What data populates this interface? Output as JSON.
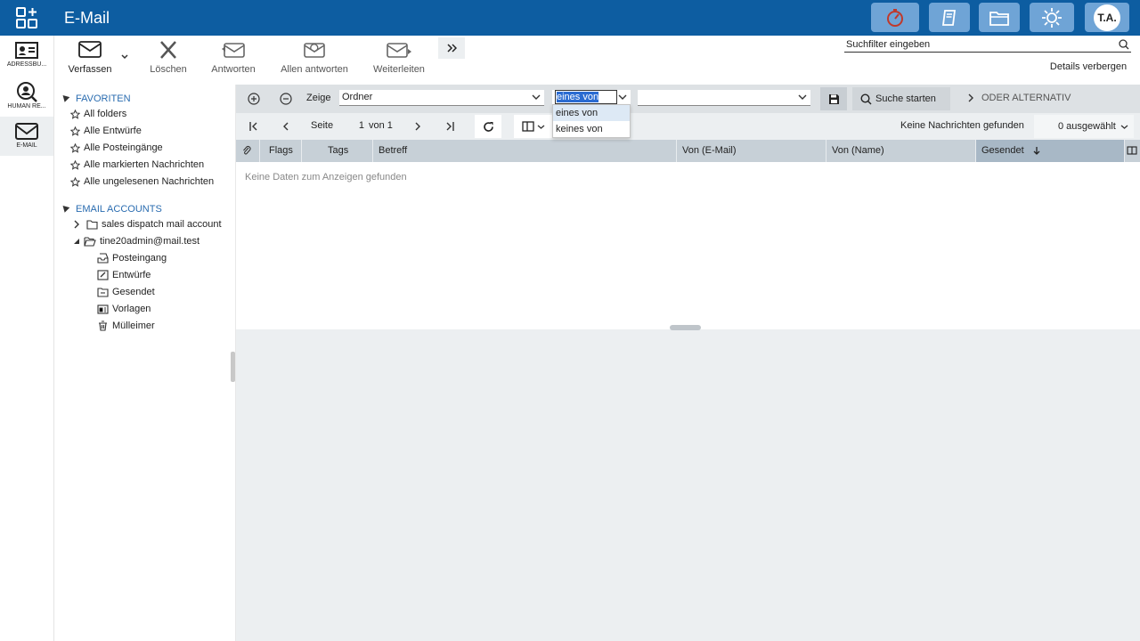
{
  "app": {
    "title": "E-Mail",
    "user_initials": "T.A."
  },
  "icons": {
    "apps": "apps-grid-icon",
    "timer": "timer-icon",
    "book": "book-icon",
    "folder": "folder-icon",
    "theme": "sun-icon"
  },
  "colors": {
    "topbar": "#0d5da1",
    "topbar_button": "#6fa4d6",
    "section_header": "#2a6cb0",
    "selection": "#2a6bd1"
  },
  "leftnav": {
    "items": [
      {
        "label": "ADRESSBU...",
        "icon": "address-card-icon"
      },
      {
        "label": "HUMAN RE...",
        "icon": "user-search-icon"
      },
      {
        "label": "E-MAIL",
        "icon": "mail-icon"
      }
    ]
  },
  "toolbar": {
    "compose": "Verfassen",
    "delete": "Löschen",
    "reply": "Antworten",
    "reply_all": "Allen antworten",
    "forward": "Weiterleiten"
  },
  "search": {
    "placeholder": "Suchfilter eingeben",
    "details_toggle": "Details verbergen"
  },
  "sidebar": {
    "favorites_header": "FAVORITEN",
    "favorites": [
      "All folders",
      "Alle Entwürfe",
      "Alle Posteingänge",
      "Alle markierten Nachrichten",
      "Alle ungelesenen Nachrichten"
    ],
    "accounts_header": "EMAIL ACCOUNTS",
    "accounts": [
      "sales dispatch mail account",
      "tine20admin@mail.test"
    ],
    "folders": [
      "Posteingang",
      "Entwürfe",
      "Gesendet",
      "Vorlagen",
      "Mülleimer"
    ]
  },
  "filter": {
    "show_label": "Zeige",
    "field_value": "Ordner",
    "operator_value": "eines von",
    "operator_options": [
      "eines von",
      "keines von"
    ],
    "search_button": "Suche starten",
    "or_alternative": "ODER ALTERNATIV"
  },
  "paging": {
    "page_label": "Seite",
    "page_value": "1",
    "of_label": "von 1",
    "status": "Keine Nachrichten gefunden",
    "selected": "0 ausgewählt"
  },
  "grid": {
    "columns": [
      "Flags",
      "Tags",
      "Betreff",
      "Von (E-Mail)",
      "Von (Name)",
      "Gesendet"
    ],
    "sorted_column": "Gesendet",
    "empty_text": "Keine Daten zum Anzeigen gefunden"
  }
}
